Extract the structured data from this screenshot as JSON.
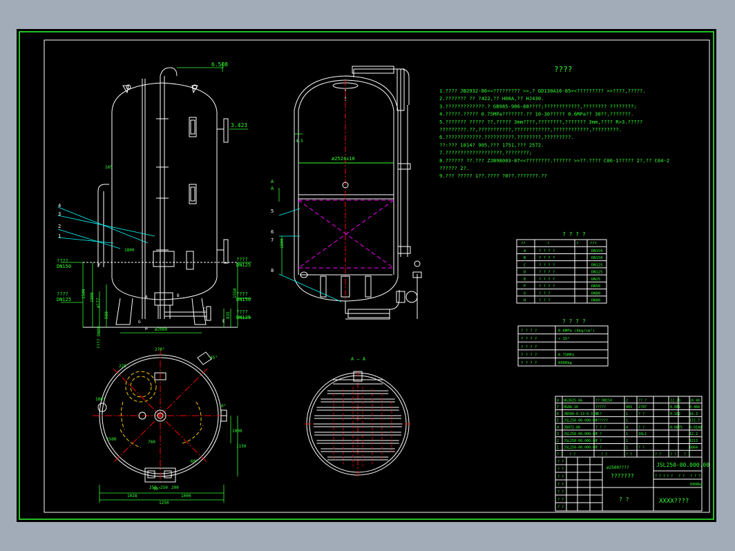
{
  "notes": {
    "title": "????",
    "lines": [
      "1.???? JB2932-86<<?????????  >>,? GD130A16-85<<?????????  >>????,?????.",
      "2.??????? ??  ?422,?? H08A,?? HJ430.",
      "3.?????????????.?    GB985-986-88????;????????????,????????     ????????;",
      "4.?????.?????  0.75MPa???????.??  10-30????? 0.6MPa?? 30??,???????.",
      "5.??????? ????? ??,?????     3mm????,????????,???????     3mm,???? R>3.?????",
      "  ?????????.??,???????????,????????????,????????????,?????????.",
      "6.????????????.??????????.????????,?????????.",
      "  ??:??? 1814? 905,??? 1751,??? 2572.",
      "7.???????????????????,????????;",
      "8.?????? ??.???   ZJB98003-87<<????????.??????   >>??.????  C06-1????? 2?,??  C04-2",
      "  ?????? 2?.",
      "9.??? ?????  1??.????  ?0??.???????.??"
    ]
  },
  "nozzle_table": {
    "title": "? ? ? ?",
    "headers": [
      "??",
      "?",
      "?",
      "???"
    ],
    "rows": [
      [
        "A",
        "? ? ? ?",
        "DN150"
      ],
      [
        "B",
        "? ? ? ?",
        "DN150"
      ],
      [
        "C",
        "? ? ? ?",
        "DN125"
      ],
      [
        "D",
        "? ? ? ?",
        "DN125"
      ],
      [
        "E",
        "? ? ? ?",
        "DN25"
      ],
      [
        "F",
        "? ? ? ?",
        "DN50"
      ],
      [
        "G",
        "? ? ?",
        "DN80"
      ],
      [
        "H",
        "? ? ?",
        "DN80"
      ]
    ]
  },
  "tech_table": {
    "title": "? ? ? ?",
    "rows": [
      [
        "? ? ? ?",
        "0.6MPa (6kg/cm²)"
      ],
      [
        "? ? ? ?",
        "< 15°"
      ],
      [
        "? ? ? ?",
        ""
      ],
      [
        "? ? ? ?",
        "0.75MPa"
      ],
      [
        "? ?   ? ?",
        "6900kg"
      ]
    ]
  },
  "bom": {
    "rows": [
      [
        "8",
        "HG3025-66",
        "?? DN150",
        "2",
        "?? ?",
        "",
        "12.20",
        "24.40"
      ],
      [
        "7",
        "HG8A-16",
        "?????",
        "403",
        "Z?07",
        "",
        "0.081",
        "0.484"
      ],
      [
        "6",
        "JB580-0.13-0.3-68",
        "? ?",
        "1",
        "? ?",
        "",
        "0.162",
        "16.3"
      ],
      [
        "5",
        "JSL250-00.090.00",
        "??????",
        "1",
        "",
        "",
        "",
        "172.7"
      ],
      [
        "4",
        "JB472-86",
        "? ? ?",
        "4",
        "? ?",
        "",
        "0.0875",
        "0.0148"
      ],
      [
        "3",
        "JSL250-00.000.00",
        "? ?",
        "1",
        "16L1",
        "",
        "",
        "12.2"
      ],
      [
        "2",
        "JSL250-00.000.00",
        "? ?",
        "1",
        "",
        "",
        "",
        "3213"
      ],
      [
        "1",
        "JSL250-00.000.00",
        "? ?",
        "1",
        "? ?",
        "",
        "",
        "6864"
      ]
    ],
    "header": [
      "? ?",
      "? ?",
      "? ?",
      "? ?",
      "? ?",
      "? ?",
      "? ?"
    ],
    "project": "ø2500????",
    "name": "???????",
    "drawing_no": "JSL250-00.000.00",
    "scale": [
      "? ? ?",
      "? ?",
      "? ?",
      "? ? ?"
    ],
    "scale_vals": [
      "",
      "",
      "",
      "6900kg"
    ],
    "material_label": "? ?",
    "company": "XXXX????",
    "signature_rows": [
      "? ?",
      "? ?",
      "? ?",
      "? ?",
      "? ?",
      "? ?",
      "? ?"
    ]
  },
  "drawing_labels": {
    "left": [
      "6.508",
      "3.423",
      "165",
      "1800",
      "????",
      "DN150",
      "????",
      "DN125",
      "????",
      "DN125",
      "????",
      "DN150",
      "????",
      "DN125",
      "???? DN80",
      "ø2080",
      "1500",
      "1900",
      "ø177",
      "580",
      "1550",
      "1950",
      "835",
      "275",
      "4",
      "3",
      "2",
      "1",
      "H",
      "G",
      "A",
      "B",
      "C",
      "D",
      "E",
      "F"
    ],
    "middle": [
      "A",
      "A",
      "4.5",
      "ø2524x10",
      "5",
      "6",
      "7",
      "8",
      "1800"
    ],
    "plan": [
      "270°",
      "90°",
      "180°",
      "0°",
      "225",
      "45°",
      "1500",
      "1000",
      "1150",
      "1028",
      "1000",
      "250",
      "250",
      "200",
      "760",
      "60°",
      "1250",
      "90°"
    ],
    "section": "A — A"
  }
}
